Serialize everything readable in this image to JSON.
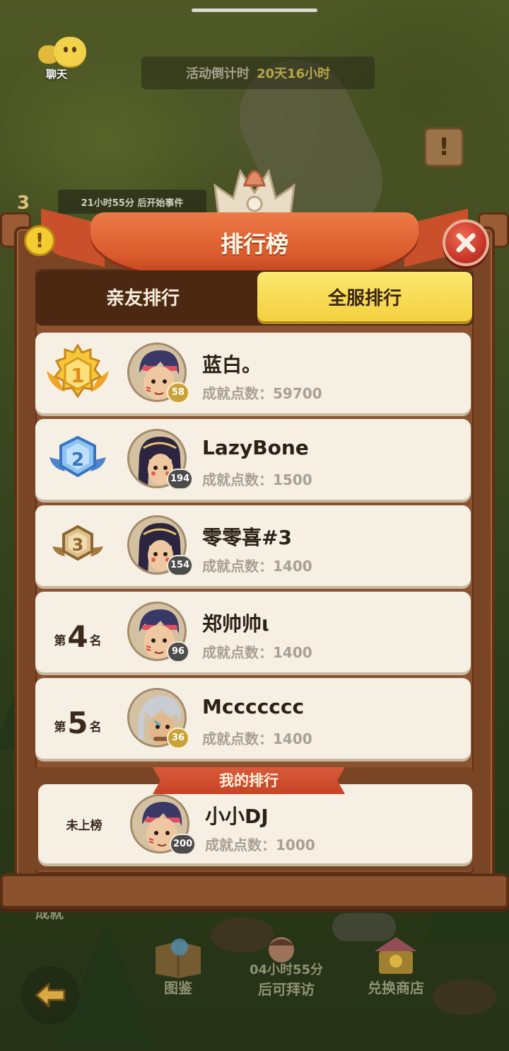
{
  "background": {
    "chat_label": "聊天",
    "countdown_label": "活动倒计时",
    "countdown_time": "20天16小时",
    "event_countdown": "21小时55分 后开始事件",
    "scarecrow_count": "3",
    "sign_glyph": "!",
    "achievement_label": "成就",
    "bottom_buttons": {
      "encyclopedia": "图鉴",
      "visit_timer": "04小时55分",
      "visit_label": "后可拜访",
      "shop": "兑换商店"
    }
  },
  "panel": {
    "title": "排行榜",
    "info_glyph": "!",
    "tabs": [
      {
        "label": "亲友排行",
        "active": false
      },
      {
        "label": "全服排行",
        "active": true
      }
    ],
    "score_prefix": "成就点数：",
    "rank_prefix": "第",
    "rank_suffix": "名",
    "entries": [
      {
        "rank": "1",
        "name": "蓝白。",
        "level": "58",
        "score": "59700",
        "avatar": "headband-boy"
      },
      {
        "rank": "2",
        "name": "LazyBone",
        "level": "194",
        "score": "1500",
        "avatar": "dark-hair-girl"
      },
      {
        "rank": "3",
        "name": "零零喜#3",
        "level": "154",
        "score": "1400",
        "avatar": "dark-hair-girl"
      },
      {
        "rank": "4",
        "name": "郑帅帅ι",
        "level": "96",
        "score": "1400",
        "avatar": "headband-boy"
      },
      {
        "rank": "5",
        "name": "Mccccccc",
        "level": "36",
        "score": "1400",
        "avatar": "white-hair-elder"
      }
    ],
    "my_rank": {
      "ribbon_label": "我的排行",
      "status": "未上榜",
      "name": "小小DJ",
      "level": "200",
      "score": "1000",
      "avatar": "headband-boy"
    }
  },
  "colors": {
    "frame_wood": "#7a4524",
    "ribbon_red": "#d95a2c",
    "active_tab_yellow": "#f4d13f",
    "row_background": "#f6f0e4",
    "gold_medal": "#f2b62c",
    "silver_medal": "#6aa7e6",
    "bronze_medal": "#c9a46a"
  }
}
